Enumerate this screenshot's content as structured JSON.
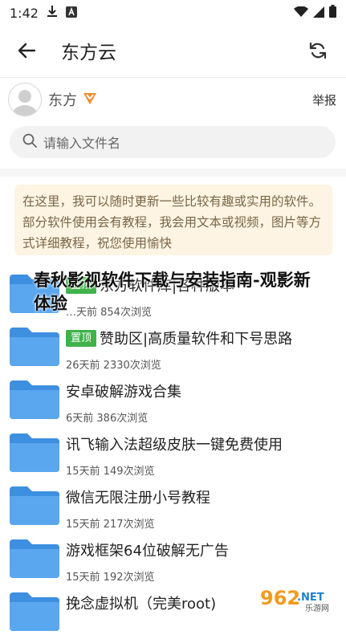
{
  "status_bar": {
    "time": "1:42",
    "icons": [
      "download-icon",
      "a-badge-icon",
      "wifi-icon",
      "signal-icon",
      "battery-icon"
    ]
  },
  "app_bar": {
    "title": "东方云",
    "back_icon": "back-arrow-icon",
    "refresh_icon": "refresh-icon"
  },
  "profile": {
    "name": "东方",
    "report": "举报"
  },
  "search": {
    "placeholder": "请输入文件名"
  },
  "notice": {
    "text": "在这里，我可以随时更新一些比较有趣或实用的软件。部分软件使用会有教程，我会用文本或视频，图片等方式详细教程，祝您使用愉快"
  },
  "overlay_title": "春秋影视软件下载与安装指南-观影新体验",
  "files": [
    {
      "pinned": true,
      "pin_label": "置顶",
      "name": "东方软件库|各种版本",
      "meta": "…天前 854次浏览"
    },
    {
      "pinned": true,
      "pin_label": "置顶",
      "name": "赞助区|高质量软件和下号思路",
      "meta": "26天前 2330次浏览"
    },
    {
      "pinned": false,
      "name": "安卓破解游戏合集",
      "meta": "6天前 386次浏览"
    },
    {
      "pinned": false,
      "name": "讯飞输入法超级皮肤一键免费使用",
      "meta": "15天前 149次浏览"
    },
    {
      "pinned": false,
      "name": "微信无限注册小号教程",
      "meta": "15天前 217次浏览"
    },
    {
      "pinned": false,
      "name": "游戏框架64位破解无广告",
      "meta": "15天前 192次浏览"
    },
    {
      "pinned": false,
      "name": "挽念虚拟机（完美root)",
      "meta": ""
    }
  ],
  "watermark": {
    "brand": "962",
    "suffix": ".NET",
    "sub": "乐游网"
  },
  "colors": {
    "folder": "#3d8fe0",
    "pin": "#3fb24a",
    "notice_bg": "#fdf4e3",
    "vip": "#f08a2a"
  }
}
